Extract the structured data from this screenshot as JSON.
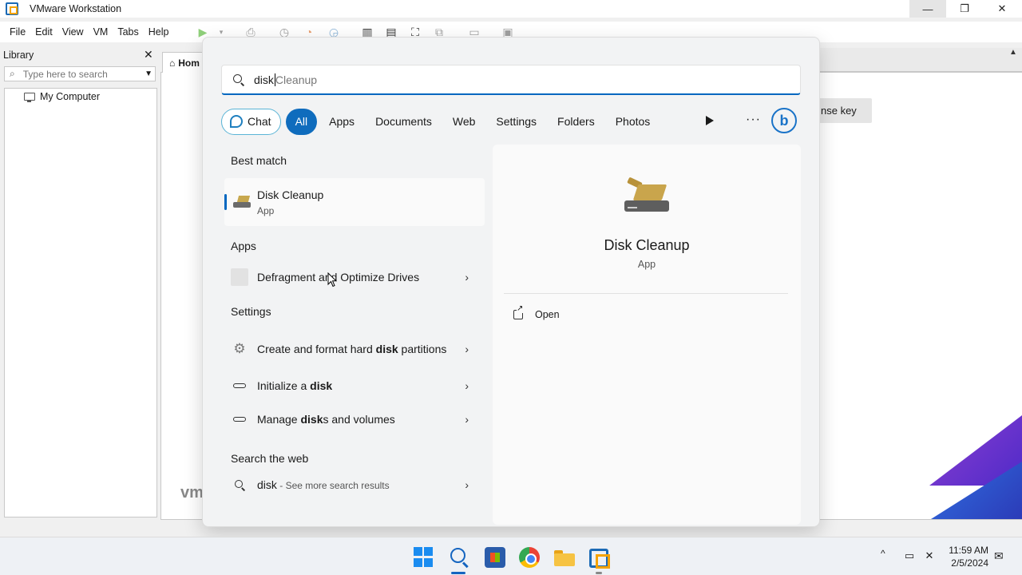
{
  "window": {
    "title": "VMware Workstation",
    "min_glyph": "—",
    "max_glyph": "❐",
    "close_glyph": "✕"
  },
  "menubar": [
    "File",
    "Edit",
    "View",
    "VM",
    "Tabs",
    "Help"
  ],
  "library": {
    "label": "Library",
    "close_glyph": "✕",
    "search_placeholder": "Type here to search",
    "tree": [
      "My Computer"
    ]
  },
  "main": {
    "tab_label": "Hom",
    "license_button": "nse key",
    "logo_text": "vm"
  },
  "search": {
    "query": "disk",
    "ghost_completion": "Cleanup",
    "filters": [
      "Chat",
      "All",
      "Apps",
      "Documents",
      "Web",
      "Settings",
      "Folders",
      "Photos"
    ],
    "active_filter": "All",
    "more_glyph": "···",
    "bing_glyph": "b",
    "sections": {
      "best_match": "Best match",
      "apps": "Apps",
      "settings": "Settings",
      "web": "Search the web"
    },
    "best_match": {
      "name_bold": "Disk",
      "name_rest": " Cleanup",
      "type": "App"
    },
    "apps": [
      {
        "label": "Defragment and Optimize Drives"
      }
    ],
    "settings": [
      {
        "pre": "Create and format hard ",
        "bold": "disk",
        "post": " partitions"
      },
      {
        "pre": "Initialize a ",
        "bold": "disk",
        "post": ""
      },
      {
        "pre": "Manage ",
        "bold": "disk",
        "post": "s and volumes"
      }
    ],
    "web": {
      "term": "disk",
      "suffix": " - See more search results"
    },
    "chevron_glyph": "›"
  },
  "preview": {
    "name": "Disk Cleanup",
    "type": "App",
    "actions": [
      "Open"
    ]
  },
  "taskbar": {
    "time": "11:59 AM",
    "date": "2/5/2024",
    "tray_chevron": "^"
  }
}
